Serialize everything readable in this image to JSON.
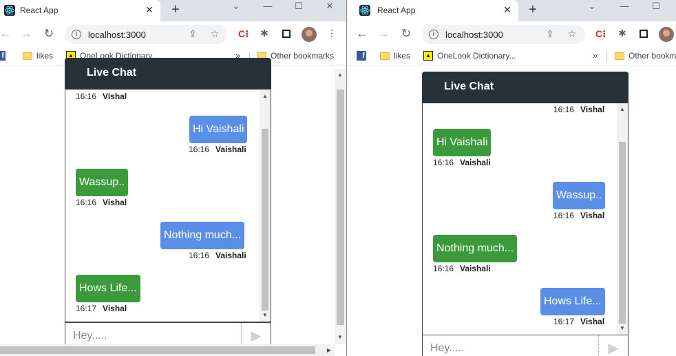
{
  "left": {
    "tab": {
      "title": "React App"
    },
    "address": {
      "url": "localhost:3000"
    },
    "bookmarks": {
      "likes": "likes",
      "onelook": "OneLook Dictionary...",
      "more": "»",
      "other": "Other bookmarks"
    },
    "chat": {
      "title": "Live Chat",
      "messages": [
        {
          "text": "",
          "time": "16:16",
          "author": "Vishal"
        },
        {
          "text": "Hi Vaishali",
          "time": "16:16",
          "author": "Vaishali"
        },
        {
          "text": "Wassup..",
          "time": "16:16",
          "author": "Vishal"
        },
        {
          "text": "Nothing much...",
          "time": "16:16",
          "author": "Vaishali"
        },
        {
          "text": "Hows Life...",
          "time": "16:17",
          "author": "Vishal"
        }
      ],
      "input_placeholder": "Hey.....",
      "send_glyph": "▶"
    }
  },
  "right": {
    "tab": {
      "title": "React App"
    },
    "address": {
      "url": "localhost:3000"
    },
    "bookmarks": {
      "likes": "likes",
      "onelook": "OneLook Dictionary...",
      "more": "»",
      "other": "Other bookm"
    },
    "chat": {
      "title": "Live Chat",
      "messages": [
        {
          "text": "",
          "time": "16:16",
          "author": "Vishal"
        },
        {
          "text": "Hi Vaishali",
          "time": "16:16",
          "author": "Vaishali"
        },
        {
          "text": "Wassup..",
          "time": "16:16",
          "author": "Vishal"
        },
        {
          "text": "Nothing much...",
          "time": "16:16",
          "author": "Vaishali"
        },
        {
          "text": "Hows Life...",
          "time": "16:17",
          "author": "Vishal"
        }
      ],
      "input_placeholder": "Hey.....",
      "send_glyph": "▶"
    }
  },
  "colors": {
    "header": "#263238",
    "bubble_green": "#3b9a3b",
    "bubble_blue": "#5b8ee6"
  },
  "icons": {
    "favicon": "react-icon",
    "close": "✕",
    "newtab": "+",
    "back": "←",
    "forward": "→",
    "reload": "↻",
    "share": "share-icon",
    "star": "☆",
    "puzzle": "puzzle-icon",
    "menu": "⋮"
  }
}
